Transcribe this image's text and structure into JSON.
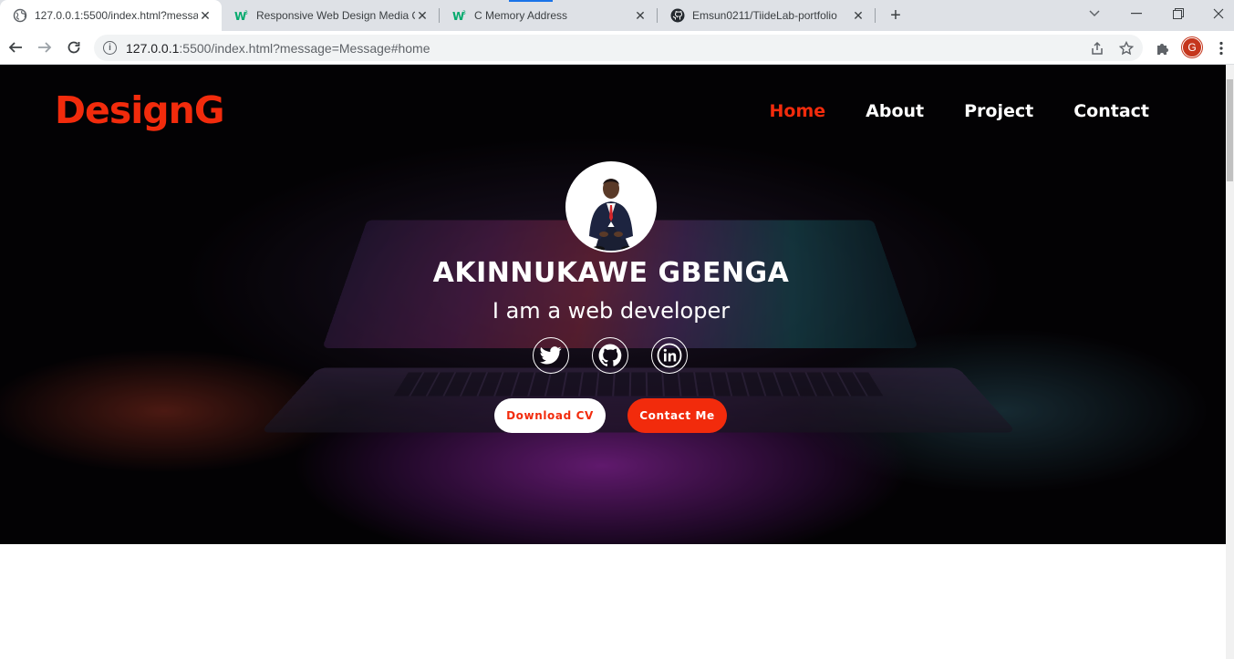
{
  "browser": {
    "tabs": [
      {
        "title": "127.0.0.1:5500/index.html?messa",
        "favicon": "globe-icon",
        "active": true
      },
      {
        "title": "Responsive Web Design Media Q",
        "favicon": "w3schools-icon",
        "active": false
      },
      {
        "title": "C Memory Address",
        "favicon": "w3schools-icon",
        "active": false
      },
      {
        "title": "Emsun0211/TiideLab-portfolio",
        "favicon": "github-icon",
        "active": false
      }
    ],
    "url_host": "127.0.0.1",
    "url_rest": ":5500/index.html?message=Message#home",
    "profile_initial": "G"
  },
  "site": {
    "brand": "DesignG",
    "nav": [
      "Home",
      "About",
      "Project",
      "Contact"
    ],
    "active_nav": "Home",
    "name": "AKINNUKAWE GBENGA",
    "tagline": "I am a web developer",
    "socials": [
      "twitter-icon",
      "github-icon",
      "linkedin-icon"
    ],
    "buttons": {
      "download_cv": "Download CV",
      "contact_me": "Contact Me"
    }
  },
  "colors": {
    "accent": "#f22b0c",
    "tabbar": "#dee1e6",
    "hero_bg": "#050306"
  }
}
